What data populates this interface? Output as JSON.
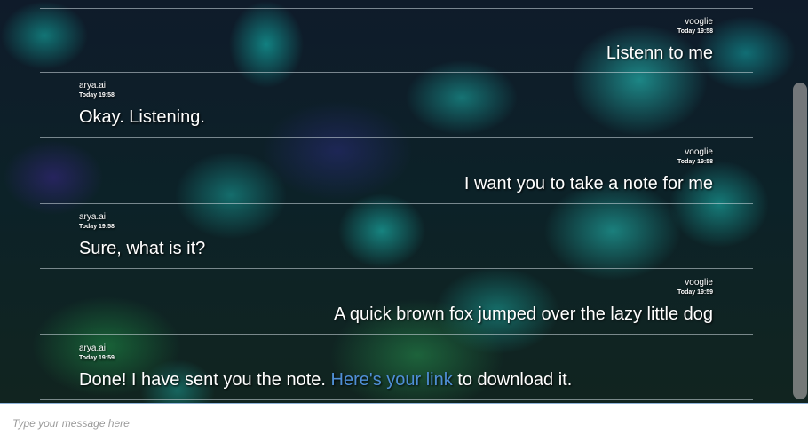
{
  "messages": [
    {
      "sender": "vooglie",
      "time": "Today 19:58",
      "text": "Listenn to me",
      "side": "right"
    },
    {
      "sender": "arya.ai",
      "time": "Today 19:58",
      "text": "Okay. Listening.",
      "side": "left"
    },
    {
      "sender": "vooglie",
      "time": "Today 19:58",
      "text": "I want you to take a note for me",
      "side": "right"
    },
    {
      "sender": "arya.ai",
      "time": "Today 19:58",
      "text": "Sure, what is it?",
      "side": "left"
    },
    {
      "sender": "vooglie",
      "time": "Today 19:59",
      "text": "A quick brown fox jumped over the lazy little dog",
      "side": "right"
    },
    {
      "sender": "arya.ai",
      "time": "Today 19:59",
      "text_before": "Done! I have sent you the note. ",
      "link_text": "Here's your link",
      "text_after": " to download it.",
      "side": "left"
    }
  ],
  "input": {
    "placeholder": "Type your message here",
    "value": ""
  },
  "colors": {
    "link": "#4f8fd6",
    "divider": "#d2dce1",
    "message_text": "#ffffff",
    "scrollbar": "#969696"
  }
}
